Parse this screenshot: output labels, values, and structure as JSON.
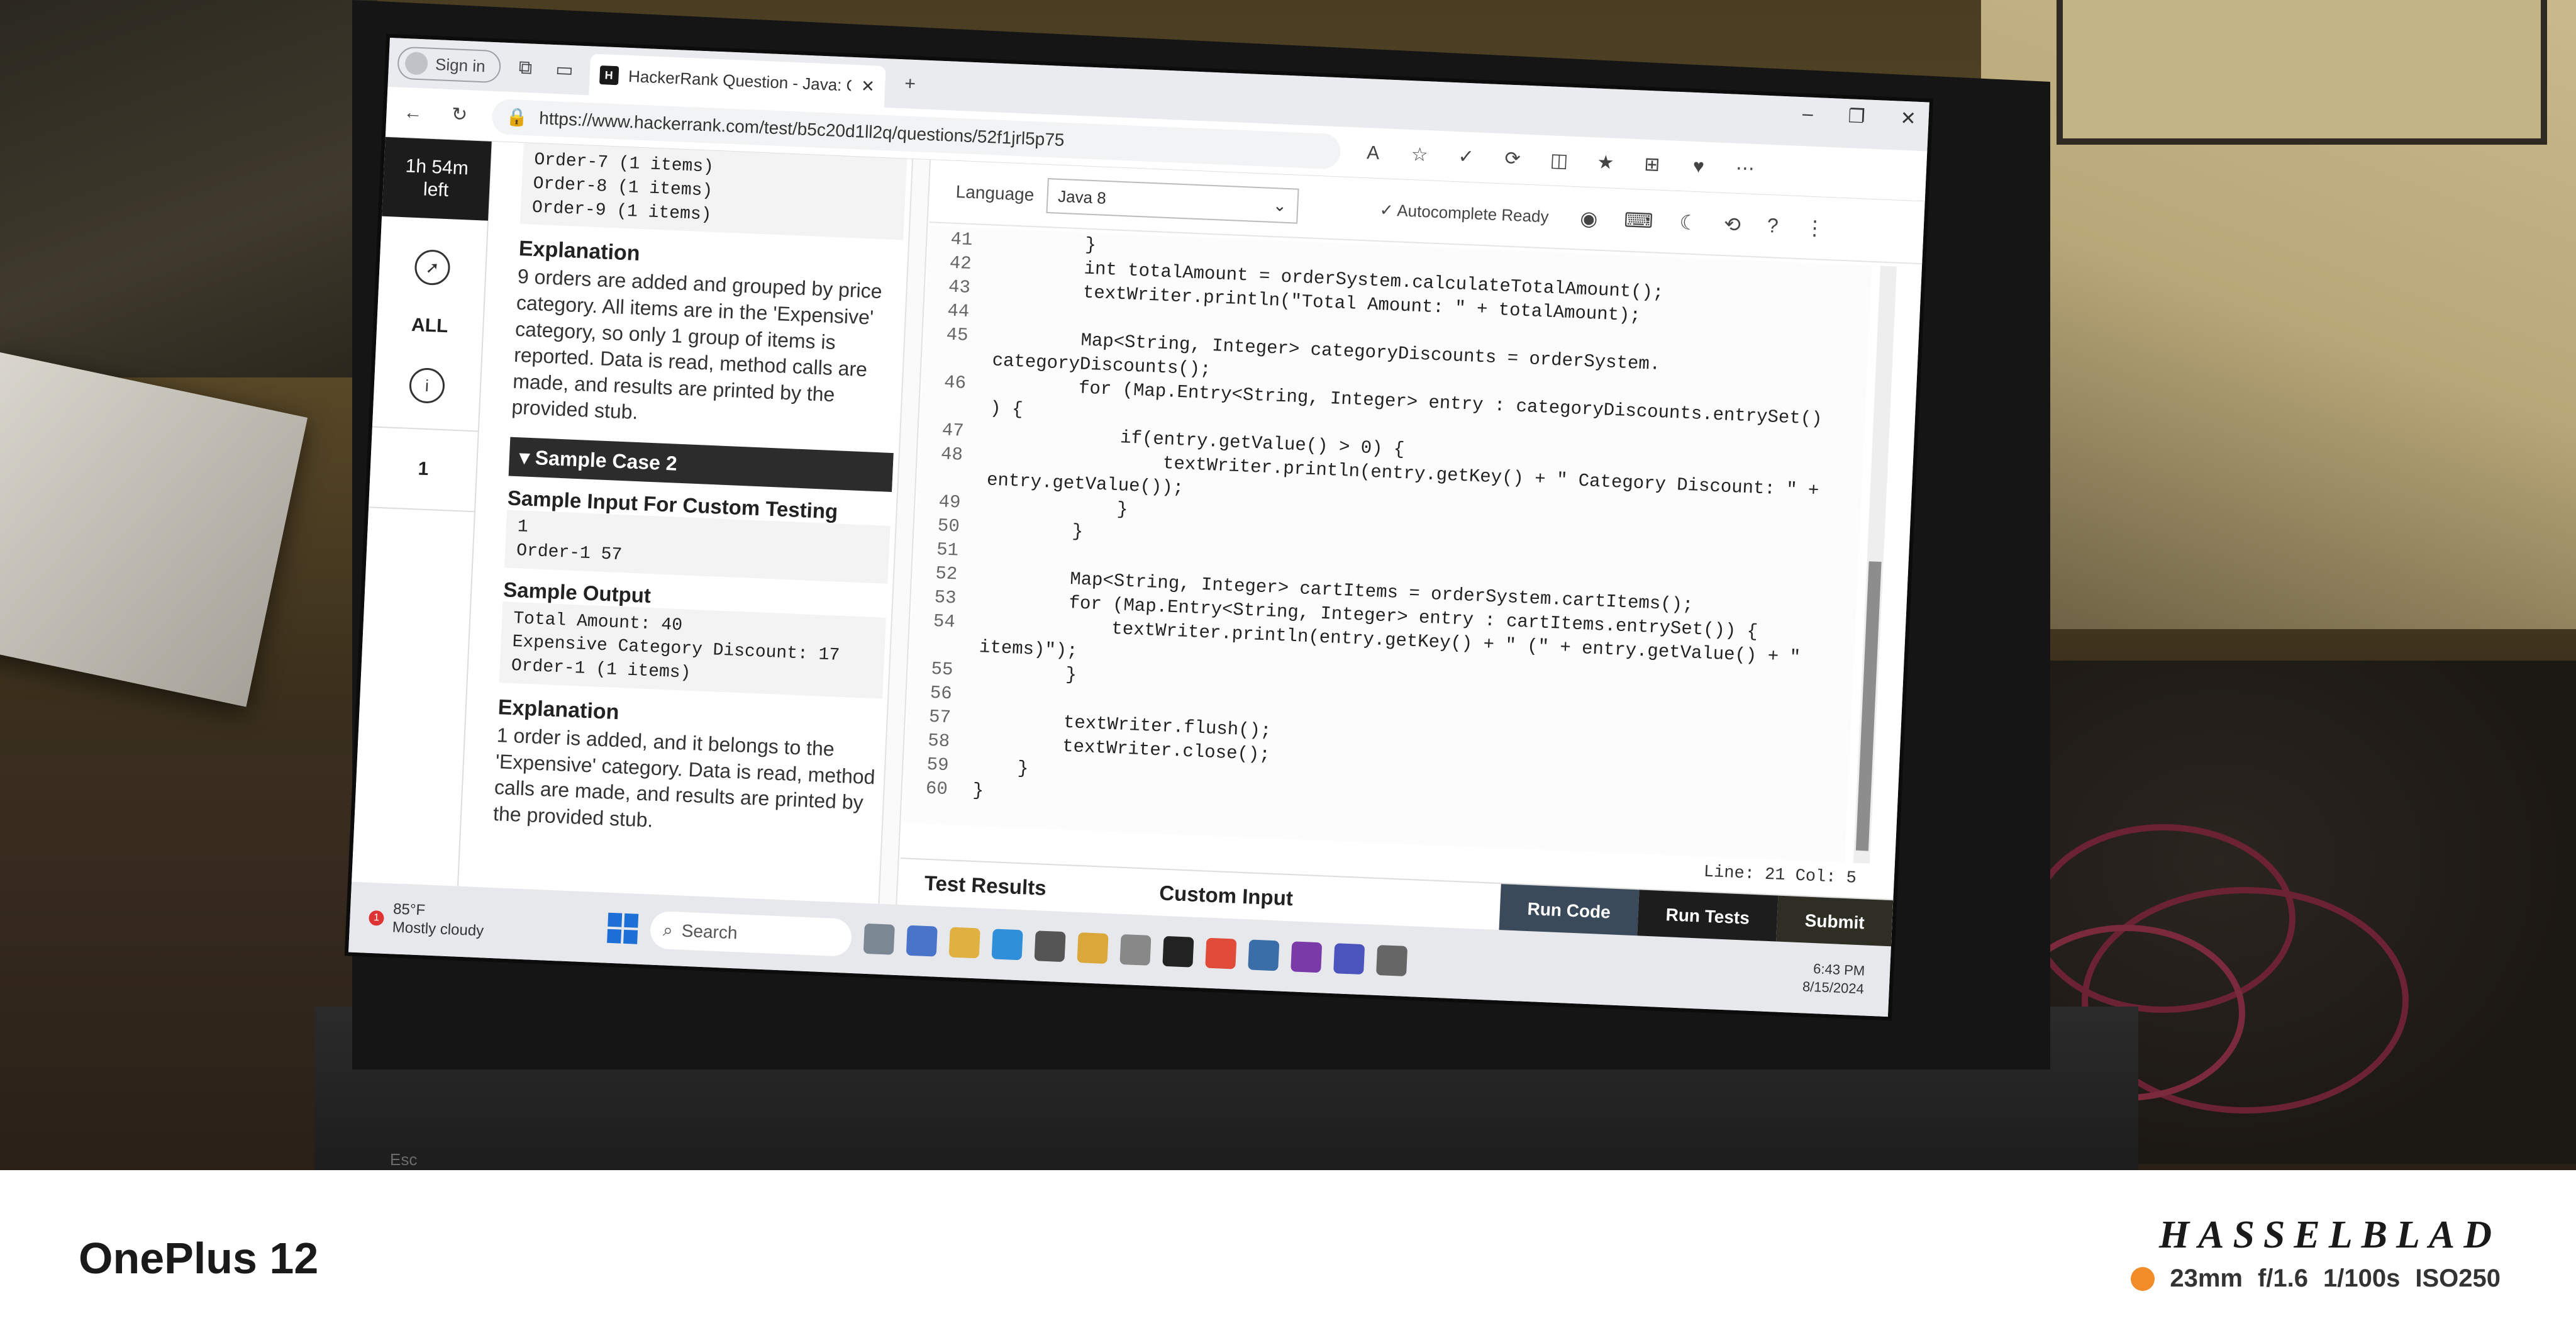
{
  "browser": {
    "signin_label": "Sign in",
    "tab_title": "HackerRank Question - Java: Orc",
    "url": "https://www.hackerrank.com/test/b5c20d1ll2q/questions/52f1jrl5p75"
  },
  "rail": {
    "timer_line1": "1h 54m",
    "timer_line2": "left",
    "all_label": "ALL",
    "question_number": "1"
  },
  "problem": {
    "top_output_lines": [
      "Order-7 (1 items)",
      "Order-8 (1 items)",
      "Order-9 (1 items)"
    ],
    "explanation1_title": "Explanation",
    "explanation1_text": "9 orders are added and grouped by price category. All items are in the 'Expensive' category, so only 1 group of items is reported. Data is read, method calls are made, and results are printed by the provided stub.",
    "case2_title": "Sample Case 2",
    "sample_input_title": "Sample Input For Custom Testing",
    "sample_input_lines": [
      "1",
      "Order-1 57"
    ],
    "sample_output_title": "Sample Output",
    "sample_output_lines": [
      "Total Amount: 40",
      "Expensive Category Discount: 17",
      "Order-1 (1 items)"
    ],
    "explanation2_title": "Explanation",
    "explanation2_text": "1 order is added, and it belongs to the 'Expensive' category. Data is read, method calls are made, and results are printed by the provided stub."
  },
  "editor": {
    "language_label": "Language",
    "language_value": "Java 8",
    "autocomplete_label": "Autocomplete Ready",
    "line_col": "Line: 21 Col: 5",
    "code_lines": [
      {
        "n": "41",
        "t": "        }"
      },
      {
        "n": "42",
        "t": "        int totalAmount = orderSystem.calculateTotalAmount();"
      },
      {
        "n": "43",
        "t": "        textWriter.println(\"Total Amount: \" + totalAmount);"
      },
      {
        "n": "44",
        "t": ""
      },
      {
        "n": "45",
        "t": "        Map<String, Integer> categoryDiscounts = orderSystem."
      },
      {
        "n": "",
        "t": "categoryDiscounts();"
      },
      {
        "n": "46",
        "t": "        for (Map.Entry<String, Integer> entry : categoryDiscounts.entrySet()"
      },
      {
        "n": "",
        "t": ") {"
      },
      {
        "n": "47",
        "t": "            if(entry.getValue() > 0) {"
      },
      {
        "n": "48",
        "t": "                textWriter.println(entry.getKey() + \" Category Discount: \" +"
      },
      {
        "n": "",
        "t": "entry.getValue());"
      },
      {
        "n": "49",
        "t": "            }"
      },
      {
        "n": "50",
        "t": "        }"
      },
      {
        "n": "51",
        "t": ""
      },
      {
        "n": "52",
        "t": "        Map<String, Integer> cartItems = orderSystem.cartItems();"
      },
      {
        "n": "53",
        "t": "        for (Map.Entry<String, Integer> entry : cartItems.entrySet()) {"
      },
      {
        "n": "54",
        "t": "            textWriter.println(entry.getKey() + \" (\" + entry.getValue() + \""
      },
      {
        "n": "",
        "t": "items)\");"
      },
      {
        "n": "55",
        "t": "        }"
      },
      {
        "n": "56",
        "t": ""
      },
      {
        "n": "57",
        "t": "        textWriter.flush();"
      },
      {
        "n": "58",
        "t": "        textWriter.close();"
      },
      {
        "n": "59",
        "t": "    }"
      },
      {
        "n": "60",
        "t": "}"
      }
    ]
  },
  "bottom": {
    "test_results_label": "Test Results",
    "custom_input_label": "Custom Input",
    "run_code_label": "Run Code",
    "run_tests_label": "Run Tests",
    "submit_label": "Submit"
  },
  "taskbar": {
    "temperature": "85°F",
    "condition": "Mostly cloudy",
    "weather_badge": "1",
    "search_label": "Search",
    "time": "6:43 PM",
    "date": "8/15/2024"
  },
  "footer": {
    "device": "OnePlus 12",
    "brand": "HASSELBLAD",
    "specs": [
      "23mm",
      "f/1.6",
      "1/100s",
      "ISO250"
    ],
    "dot_color": "#f28c28"
  },
  "keyboard": {
    "esc_label": "Esc"
  }
}
